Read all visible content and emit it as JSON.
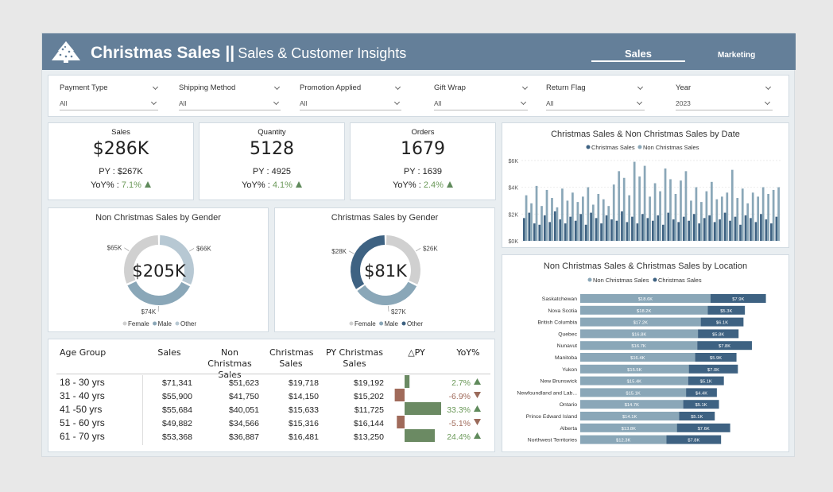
{
  "header": {
    "title": "Christmas Sales",
    "separator": "||",
    "subtitle": "Sales & Customer Insights",
    "nav": [
      {
        "label": "Sales",
        "active": true
      },
      {
        "label": "Marketing",
        "active": false
      }
    ],
    "bg_color": "#647f99"
  },
  "filters": [
    {
      "label": "Payment Type",
      "value": "All"
    },
    {
      "label": "Shipping Method",
      "value": "All"
    },
    {
      "label": "Promotion Applied",
      "value": "All"
    },
    {
      "label": "Gift Wrap",
      "value": "All"
    },
    {
      "label": "Return Flag",
      "value": "All"
    },
    {
      "label": "Year",
      "value": "2023"
    }
  ],
  "kpis": [
    {
      "title": "Sales",
      "value": "$286K",
      "py_label": "PY : ",
      "py_value": "$267K",
      "yoy_label": "YoY% : ",
      "yoy_value": "7.1%",
      "trend": "up"
    },
    {
      "title": "Quantity",
      "value": "5128",
      "py_label": "PY : ",
      "py_value": "4925",
      "yoy_label": "YoY% : ",
      "yoy_value": "4.1%",
      "trend": "up"
    },
    {
      "title": "Orders",
      "value": "1679",
      "py_label": "PY : ",
      "py_value": "1639",
      "yoy_label": "YoY% : ",
      "yoy_value": "2.4%",
      "trend": "up"
    }
  ],
  "colors": {
    "dark_blue": "#3e6282",
    "mid_blue": "#8aa7b8",
    "light_grey": "#d0d0d0",
    "green": "#6b8a63",
    "red": "#a06a5a"
  },
  "chart_data": [
    {
      "type": "pie",
      "title": "Non Christmas Sales by Gender",
      "center_label": "$205K",
      "categories": [
        "Female",
        "Male",
        "Other"
      ],
      "values": [
        65,
        74,
        66
      ],
      "data_labels": [
        "$65K",
        "$74K",
        "$66K"
      ],
      "legend": [
        "Female",
        "Male",
        "Other"
      ]
    },
    {
      "type": "pie",
      "title": "Christmas Sales by Gender",
      "center_label": "$81K",
      "categories": [
        "Female",
        "Male",
        "Other"
      ],
      "values": [
        28,
        27,
        26
      ],
      "data_labels": [
        "$28K",
        "$27K",
        "$26K"
      ],
      "legend": [
        "Female",
        "Male",
        "Other"
      ]
    },
    {
      "type": "bar",
      "title": "Christmas Sales & Non Christmas Sales by Date",
      "series": [
        {
          "name": "Christmas Sales",
          "values": [
            1700,
            2100,
            1300,
            1200,
            1900,
            1400,
            2200,
            1600,
            1300,
            1800,
            1500,
            2000,
            1200,
            2100,
            1700,
            1300,
            1900,
            1600,
            1500,
            2200,
            1400,
            1800,
            1300,
            2000,
            1700,
            1500,
            1900,
            1200,
            2100,
            1600,
            1400,
            1800,
            1500,
            2000,
            1300,
            1700,
            1900,
            1400,
            1600,
            2100,
            1500,
            1800,
            1200,
            1900,
            1700,
            1400,
            2000,
            1600,
            1300,
            1800
          ]
        },
        {
          "name": "Non Christmas Sales",
          "values": [
            3400,
            2800,
            4100,
            2600,
            3800,
            3200,
            2500,
            3900,
            3000,
            3600,
            2900,
            3300,
            4000,
            2700,
            3500,
            3100,
            2600,
            4200,
            5200,
            4700,
            3400,
            5900,
            4800,
            5600,
            3300,
            4300,
            3700,
            5400,
            4600,
            3500,
            4500,
            5200,
            3000,
            4000,
            2900,
            3700,
            4400,
            3100,
            3300,
            3600,
            5300,
            3200,
            3900,
            2800,
            3600,
            3300,
            4000,
            3500,
            3800,
            4000
          ]
        }
      ],
      "y_ticks": [
        "$0K",
        "$2K",
        "$4K",
        "$6K"
      ],
      "ylim": [
        0,
        7000
      ]
    },
    {
      "type": "bar",
      "title": "Non Christmas Sales & Christmas Sales by Location",
      "categories": [
        "Saskatchewan",
        "Nova Scotia",
        "British Columbia",
        "Quebec",
        "Nunavut",
        "Manitoba",
        "Yukon",
        "New Brunswick",
        "Newfoundland and Lab...",
        "Ontario",
        "Prince Edward Island",
        "Alberta",
        "Northwest Territories"
      ],
      "series": [
        {
          "name": "Non Christmas Sales",
          "values": [
            18.6,
            18.2,
            17.2,
            16.8,
            16.7,
            16.4,
            15.5,
            15.4,
            15.1,
            14.7,
            14.1,
            13.8,
            12.3
          ],
          "labels": [
            "$18.6K",
            "$18.2K",
            "$17.2K",
            "$16.8K",
            "$16.7K",
            "$16.4K",
            "$15.5K",
            "$15.4K",
            "$15.1K",
            "$14.7K",
            "$14.1K",
            "$13.8K",
            "$12.3K"
          ]
        },
        {
          "name": "Christmas Sales",
          "values": [
            7.9,
            5.3,
            6.1,
            5.8,
            7.8,
            5.9,
            7.0,
            5.1,
            4.4,
            5.1,
            5.1,
            7.6,
            7.8
          ],
          "labels": [
            "$7.9K",
            "$5.3K",
            "$6.1K",
            "$5.8K",
            "$7.8K",
            "$5.9K",
            "$7.0K",
            "$5.1K",
            "$4.4K",
            "$5.1K",
            "$5.1K",
            "$7.6K",
            "$7.8K"
          ]
        }
      ],
      "orientation": "horizontal",
      "stacked": true
    }
  ],
  "age_table": {
    "headers": [
      "Age Group",
      "Sales",
      "Non Christmas Sales",
      "Christmas Sales",
      "PY Christmas Sales",
      "△PY",
      "YoY%"
    ],
    "rows": [
      {
        "age": "18 - 30 yrs",
        "sales": "$71,341",
        "non_xmas": "$51,623",
        "xmas": "$19,718",
        "py": "$19,192",
        "delta": 526,
        "yoy": "2.7%",
        "trend": "up"
      },
      {
        "age": "31 - 40 yrs",
        "sales": "$55,900",
        "non_xmas": "$41,750",
        "xmas": "$14,150",
        "py": "$15,202",
        "delta": -1052,
        "yoy": "-6.9%",
        "trend": "down"
      },
      {
        "age": "41 -50 yrs",
        "sales": "$55,684",
        "non_xmas": "$40,051",
        "xmas": "$15,633",
        "py": "$11,725",
        "delta": 3908,
        "yoy": "33.3%",
        "trend": "up"
      },
      {
        "age": "51 - 60 yrs",
        "sales": "$49,882",
        "non_xmas": "$34,566",
        "xmas": "$15,316",
        "py": "$16,144",
        "delta": -828,
        "yoy": "-5.1%",
        "trend": "down"
      },
      {
        "age": "61 - 70 yrs",
        "sales": "$53,368",
        "non_xmas": "$36,887",
        "xmas": "$16,481",
        "py": "$13,250",
        "delta": 3231,
        "yoy": "24.4%",
        "trend": "up"
      }
    ]
  }
}
